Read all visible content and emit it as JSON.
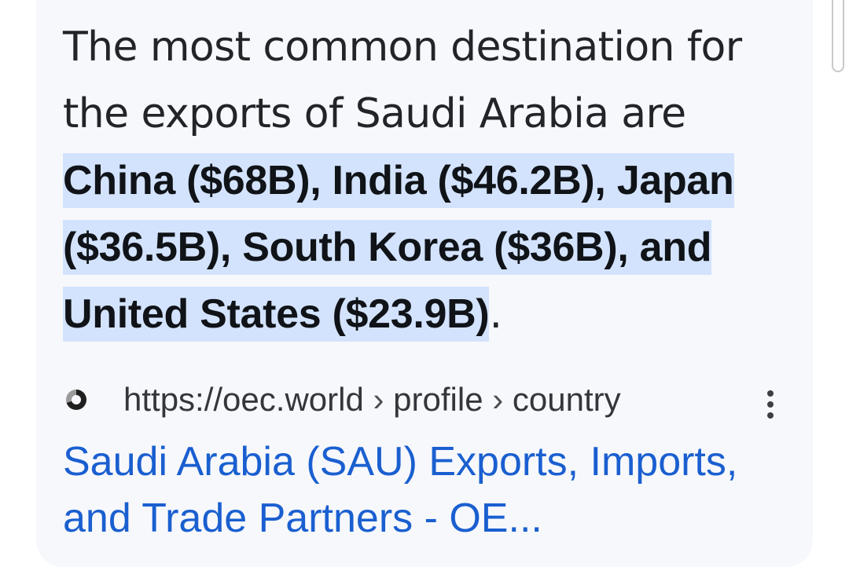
{
  "snippet": {
    "intro": "The most common destination for the exports of Saudi Arabia are ",
    "highlight": "China ($68B), India ($46.2B), Japan ($36.5B), South Korea ($36B), and United States ($23.9B)",
    "end": "."
  },
  "source": {
    "favicon": "oec-logo-icon",
    "domain": "https://oec.world",
    "separator": "›",
    "path1": "profile",
    "path2": "country",
    "more_icon": "more-vert-icon"
  },
  "result": {
    "title": "Saudi Arabia (SAU) Exports, Imports, and Trade Partners - OE..."
  },
  "colors": {
    "highlight": "#d3e3fd",
    "link": "#1a5fd0",
    "card": "#f7f8fc"
  }
}
